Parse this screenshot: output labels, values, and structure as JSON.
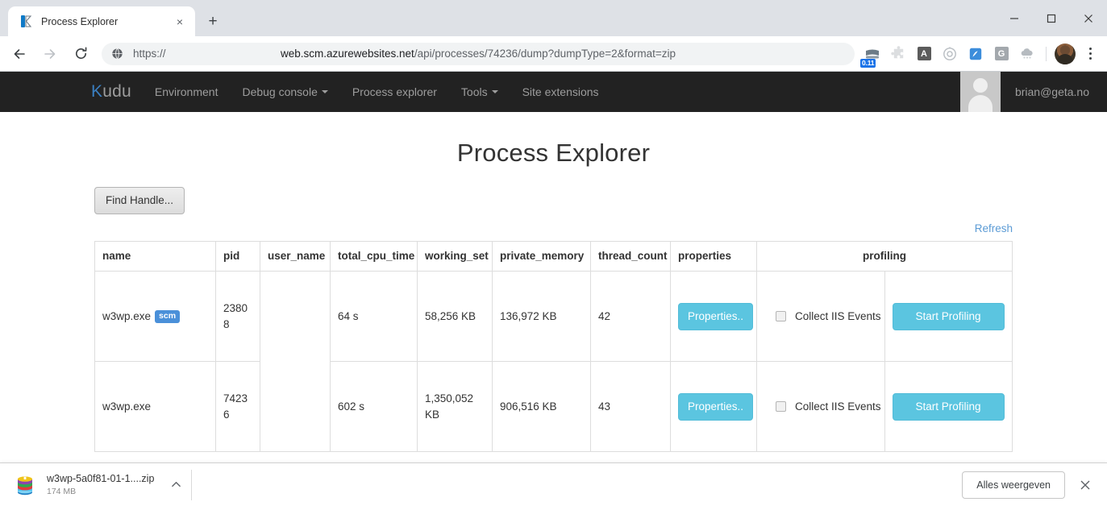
{
  "browser": {
    "tab": {
      "title": "Process Explorer",
      "favicon": "kudu-favicon",
      "close_label": "×"
    },
    "new_tab_label": "+",
    "window_controls": {
      "minimize": "minimize-icon",
      "maximize": "maximize-icon",
      "close": "close-icon"
    },
    "nav": {
      "back": "back-arrow-icon",
      "forward": "forward-arrow-icon",
      "reload": "reload-icon"
    },
    "omnibox": {
      "scheme_prefix": "https://",
      "host": "web.scm.azurewebsites.net",
      "path": "/api/processes/74236/dump?dumpType=2&format=zip",
      "security_icon": "globe-icon"
    },
    "extensions": [
      {
        "name": "reader-extension-icon",
        "badge": "0.11",
        "color": "#6d7c87"
      },
      {
        "name": "puzzle-extension-icon",
        "badge": "",
        "color": "#d6d8da"
      },
      {
        "name": "adblock-a-icon",
        "badge": "",
        "color": "#5b5b5b",
        "letter": "A"
      },
      {
        "name": "target-extension-icon",
        "badge": "",
        "color": "#9aa0a6"
      },
      {
        "name": "blue-bird-extension-icon",
        "badge": "",
        "color": "#3c8ddb"
      },
      {
        "name": "google-g-extension-icon",
        "badge": "",
        "color": "#9aa0a6",
        "letter": "G"
      },
      {
        "name": "cloud-extension-icon",
        "badge": "",
        "color": "#9aa0a6"
      }
    ],
    "profile_avatar": "profile-avatar",
    "menu": "three-dot-menu-icon"
  },
  "kudu": {
    "brand_k": "K",
    "brand_rest": "udu",
    "nav_items": [
      {
        "label": "Environment",
        "has_caret": false
      },
      {
        "label": "Debug console",
        "has_caret": true
      },
      {
        "label": "Process explorer",
        "has_caret": false
      },
      {
        "label": "Tools",
        "has_caret": true
      },
      {
        "label": "Site extensions",
        "has_caret": false
      }
    ],
    "user_email": "brian@geta.no"
  },
  "page": {
    "title": "Process Explorer",
    "find_handle_label": "Find Handle...",
    "refresh_label": "Refresh"
  },
  "table": {
    "headers": [
      "name",
      "pid",
      "user_name",
      "total_cpu_time",
      "working_set",
      "private_memory",
      "thread_count",
      "properties",
      "profiling"
    ],
    "rows": [
      {
        "name": "w3wp.exe",
        "badge": "scm",
        "pid": "23808",
        "user_name": "",
        "total_cpu_time": "64 s",
        "working_set": "58,256 KB",
        "private_memory": "136,972 KB",
        "thread_count": "42",
        "properties_label": "Properties..",
        "iis_label": "Collect IIS Events",
        "iis_checked": false,
        "start_profiling_label": "Start Profiling"
      },
      {
        "name": "w3wp.exe",
        "badge": "",
        "pid": "74236",
        "user_name": "",
        "total_cpu_time": "602 s",
        "working_set": "1,350,052 KB",
        "private_memory": "906,516 KB",
        "thread_count": "43",
        "properties_label": "Properties..",
        "iis_label": "Collect IIS Events",
        "iis_checked": false,
        "start_profiling_label": "Start Profiling"
      }
    ]
  },
  "downloads": {
    "file_name": "w3wp-5a0f81-01-1....zip",
    "file_size": "174 MB",
    "file_icon": "archive-zip-icon",
    "expand_icon": "chevron-up-icon",
    "show_all_label": "Alles weergeven",
    "close_label": "×"
  },
  "colors": {
    "accent_button": "#5bc5e0",
    "badge_blue": "#4a90d9",
    "link_blue": "#5b9bd5",
    "navbar_dark": "#222222"
  }
}
